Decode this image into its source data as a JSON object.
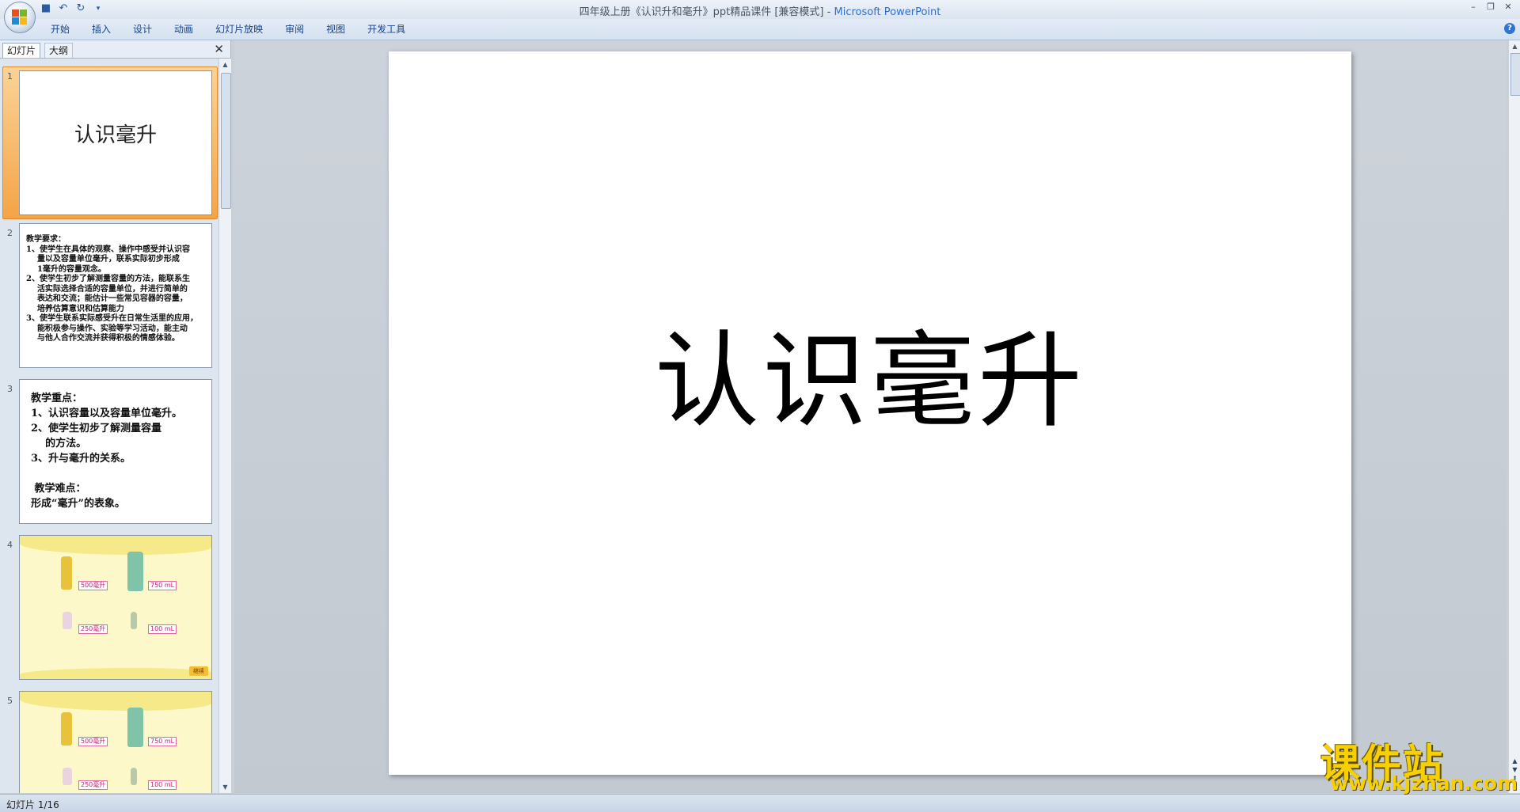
{
  "window": {
    "title": "四年级上册《认识升和毫升》ppt精品课件 [兼容模式]",
    "app_name": "Microsoft PowerPoint",
    "separator": " - "
  },
  "quick_access": [
    "save-icon",
    "undo-icon",
    "redo-icon",
    "customize-icon"
  ],
  "ribbon": {
    "tabs": [
      "开始",
      "插入",
      "设计",
      "动画",
      "幻灯片放映",
      "审阅",
      "视图",
      "开发工具"
    ]
  },
  "left_pane": {
    "tabs": {
      "slides": "幻灯片",
      "outline": "大纲"
    },
    "slides": [
      {
        "number": "1",
        "title": "认识毫升"
      },
      {
        "number": "2",
        "text": "教学要求：\n1、使学生在具体的观察、操作中感受并认识容\n    量以及容量单位毫升，联系实际初步形成\n    1毫升的容量观念。\n2、使学生初步了解测量容量的方法，能联系生\n    活实际选择合适的容量单位，并进行简单的\n    表达和交流；能估计一些常见容器的容量，\n    培养估算意识和估算能力\n3、使学生联系实际感受升在日常生活里的应用，\n    能积极参与操作、实验等学习活动，能主动\n    与他人合作交流并获得积极的情感体验。"
      },
      {
        "number": "3",
        "text": "教学重点：\n1、认识容量以及容量单位毫升。\n2、使学生初步了解测量容量\n    的方法。\n3、升与毫升的关系。\n\n 教学难点：\n形成“毫升”的表象。"
      },
      {
        "number": "4",
        "labels": [
          "500毫升",
          "750 mL",
          "250毫升",
          "100 mL"
        ],
        "button": "继续"
      },
      {
        "number": "5",
        "labels": [
          "500毫升",
          "750 mL",
          "250毫升",
          "100 mL"
        ]
      }
    ]
  },
  "main_slide": {
    "title": "认识毫升"
  },
  "status": {
    "slide_counter": "幻灯片 1/16"
  },
  "watermark": {
    "text": "课件站",
    "url": "www.kjzhan.com"
  }
}
